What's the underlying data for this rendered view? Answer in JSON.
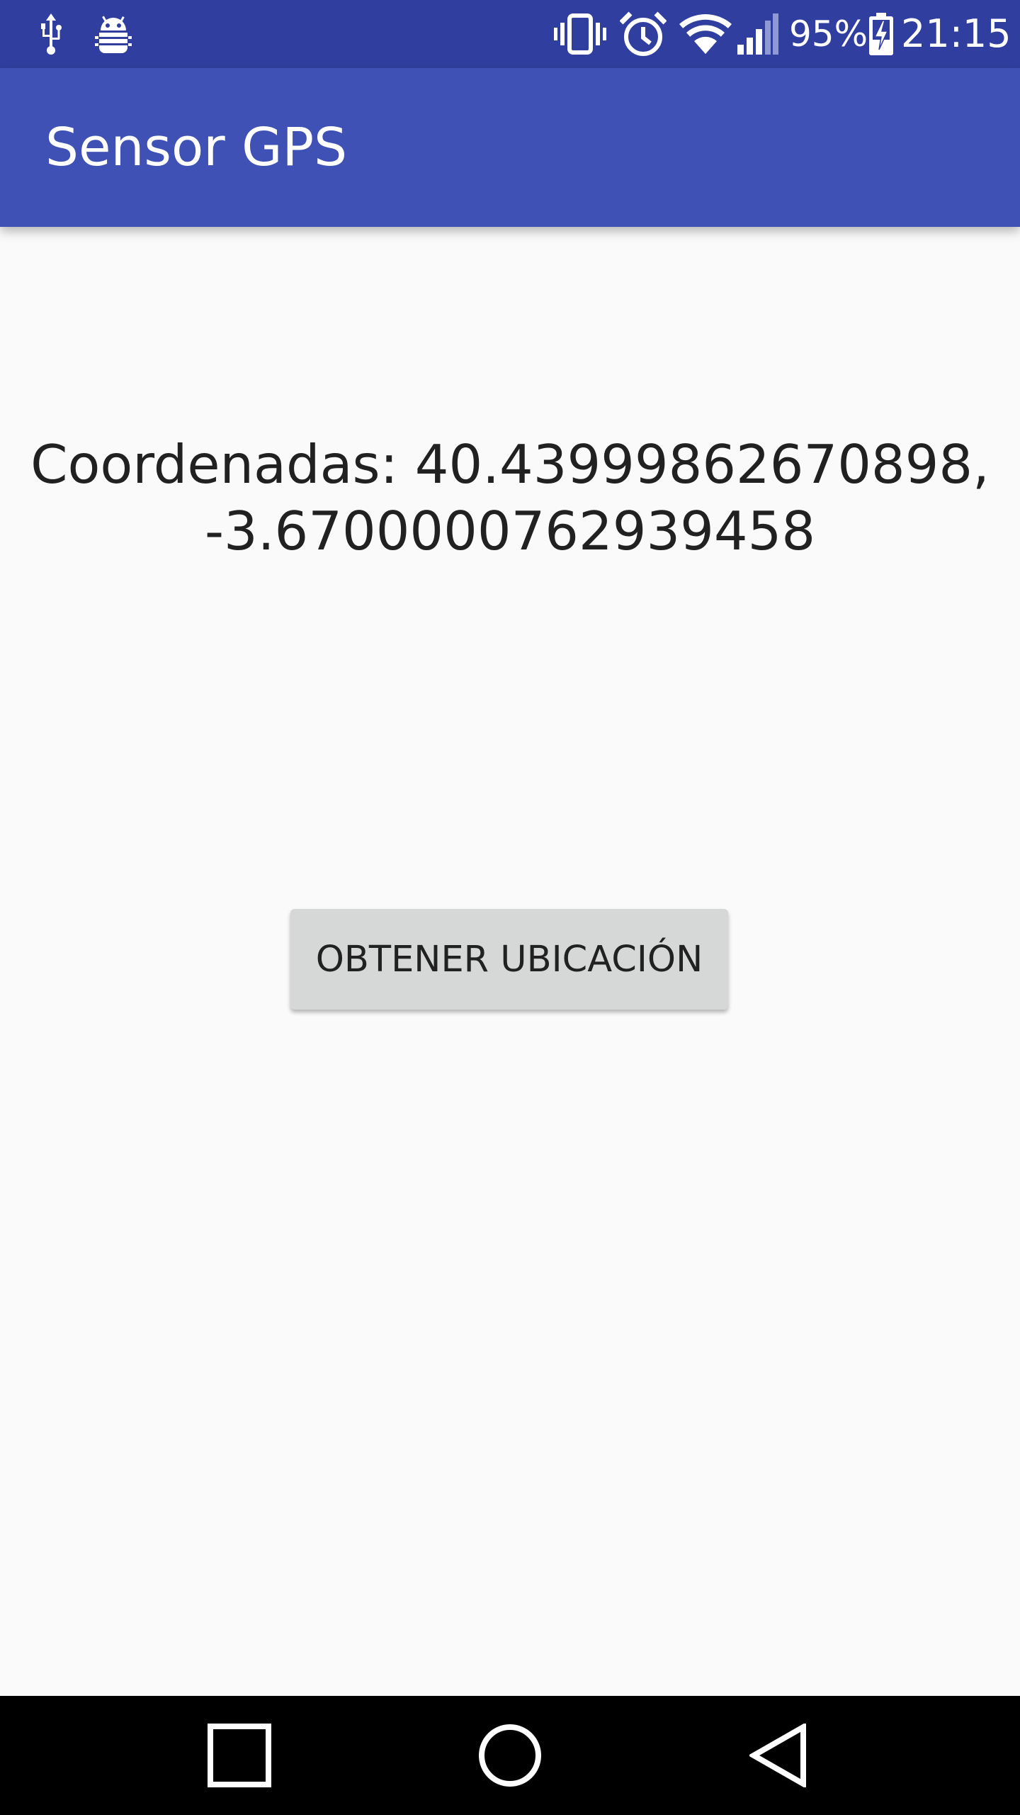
{
  "status_bar": {
    "battery_percent": "95%",
    "time": "21:15",
    "icons": [
      "usb-icon",
      "android-debug-icon",
      "vibrate-icon",
      "alarm-icon",
      "wifi-icon",
      "cell-signal-icon",
      "battery-charging-icon"
    ],
    "color": "#303f9f"
  },
  "app_bar": {
    "title": "Sensor GPS",
    "color": "#3f51b5"
  },
  "main": {
    "coordinates_text": "Coordenadas: 40.43999862670898, -3.6700000762939458",
    "button_label": "OBTENER UBICACIÓN"
  },
  "nav_bar": {
    "icons": [
      "recents-square-icon",
      "home-circle-icon",
      "back-triangle-icon"
    ]
  }
}
